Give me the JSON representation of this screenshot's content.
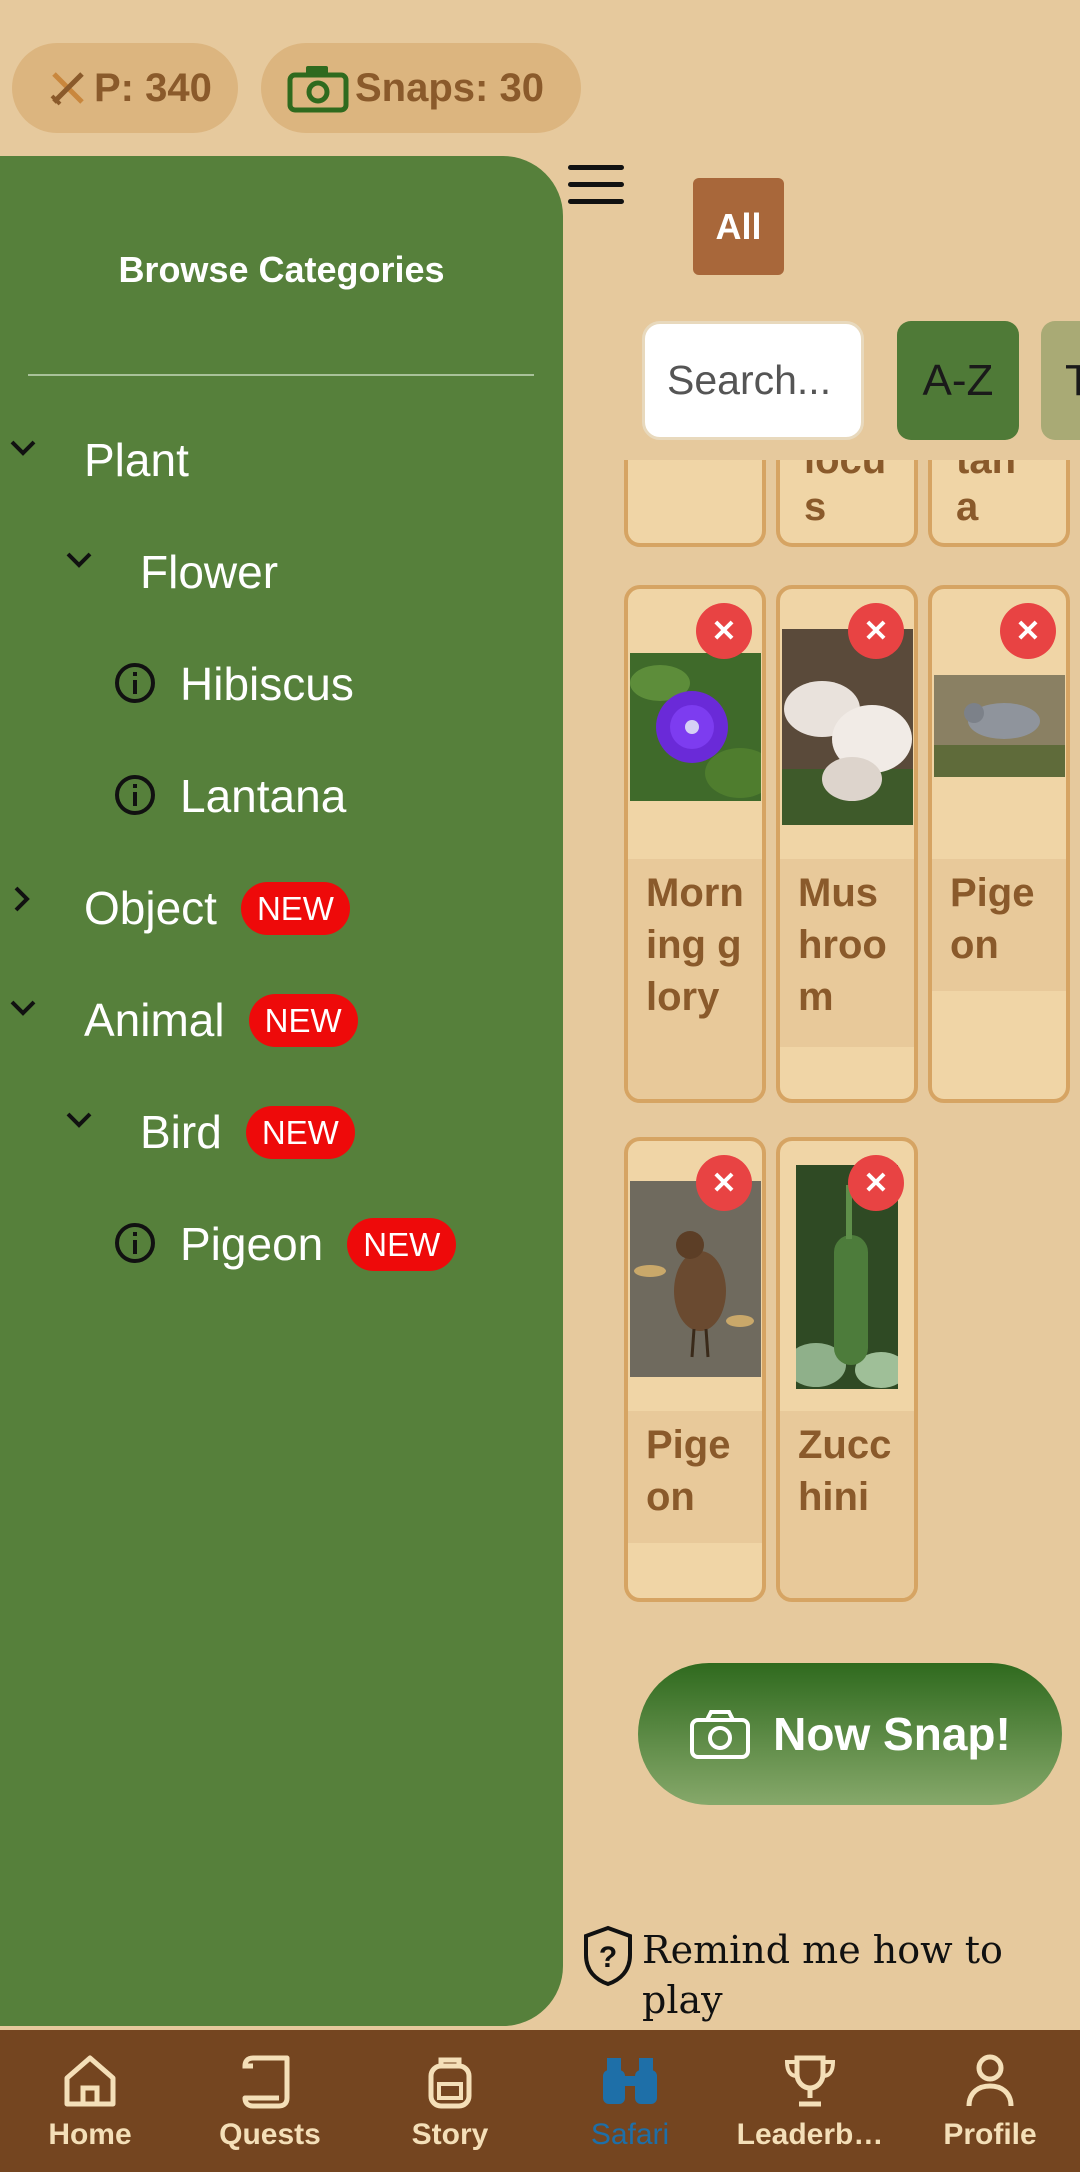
{
  "stats": {
    "points_label": "P: 340",
    "snaps_label": "Snaps: 30"
  },
  "filters": {
    "all_label": "All",
    "search_placeholder": "Search...",
    "sort_az_label": "A-Z",
    "sort_t_label": "T"
  },
  "partial_cards": [
    {
      "text_line1": "locu",
      "text_line2": "s"
    },
    {
      "text_line1": "tan",
      "text_line2": "a"
    }
  ],
  "cards": [
    {
      "name": "Morning glory"
    },
    {
      "name": "Mushroom"
    },
    {
      "name": "Pigeon"
    },
    {
      "name": "Pigeon"
    },
    {
      "name": "Zucchini"
    }
  ],
  "sidebar": {
    "title": "Browse Categories",
    "tree": [
      {
        "label": "Plant",
        "level": 0,
        "type": "expanded"
      },
      {
        "label": "Flower",
        "level": 1,
        "type": "expanded"
      },
      {
        "label": "Hibiscus",
        "level": 2,
        "type": "info"
      },
      {
        "label": "Lantana",
        "level": 2,
        "type": "info"
      },
      {
        "label": "Object",
        "level": 0,
        "type": "collapsed",
        "badge": "NEW"
      },
      {
        "label": "Animal",
        "level": 0,
        "type": "expanded",
        "badge": "NEW"
      },
      {
        "label": "Bird",
        "level": 1,
        "type": "expanded",
        "badge": "NEW"
      },
      {
        "label": "Pigeon",
        "level": 2,
        "type": "info",
        "badge": "NEW"
      }
    ]
  },
  "snap_button": {
    "label": "Now Snap!"
  },
  "remind": {
    "text": "Remind me how to play"
  },
  "nav": {
    "home": "Home",
    "quests": "Quests",
    "story": "Story",
    "safari": "Safari",
    "leaderboard": "Leaderb…",
    "profile": "Profile"
  },
  "colors": {
    "background": "#e6c99d",
    "sidebar": "#56803b",
    "nav": "#744520",
    "badge": "#ee0a0a",
    "active_nav": "#1e6fa8"
  }
}
